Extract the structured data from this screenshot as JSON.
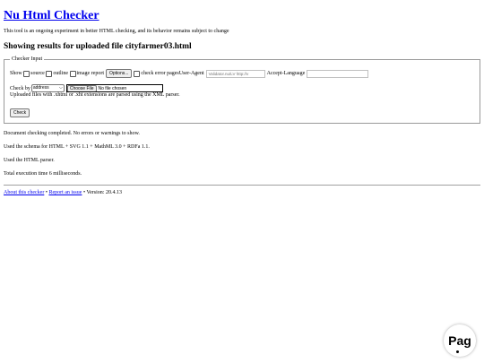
{
  "page": {
    "title": "Nu Html Checker",
    "intro": "This tool is an ongoing experiment in better HTML checking, and its behavior remains subject to change",
    "results_heading": "Showing results for uploaded file cityfarmer03.html"
  },
  "form": {
    "legend": "Checker Input",
    "show_label": "Show",
    "source_label": "source",
    "outline_label": "outline",
    "image_report_label": "image report",
    "options_button": "Options...",
    "check_error_pages_label": "check error pages",
    "user_agent_label": "User-Agent",
    "user_agent_value": "Validator.nu/LV http://v",
    "accept_language_label": "Accept-Language",
    "accept_language_value": "",
    "check_by_label": "Check by",
    "check_by_selected": "address",
    "choose_file_button": "Choose File",
    "file_status": "No file chosen",
    "upload_note": "Uploaded files with .xhtml or .xht extensions are parsed using the XML parser.",
    "check_button": "Check"
  },
  "results": [
    "Document checking completed. No errors or warnings to show.",
    "Used the schema for HTML + SVG 1.1 + MathML 3.0 + RDFa 1.1.",
    "Used the HTML parser.",
    "Total execution time 6 milliseconds."
  ],
  "footer": {
    "about_link": "About this checker",
    "separator": "•",
    "report_link": "Report an issue",
    "version": "Version: 20.4.13"
  },
  "badge": {
    "text": "Pag"
  }
}
